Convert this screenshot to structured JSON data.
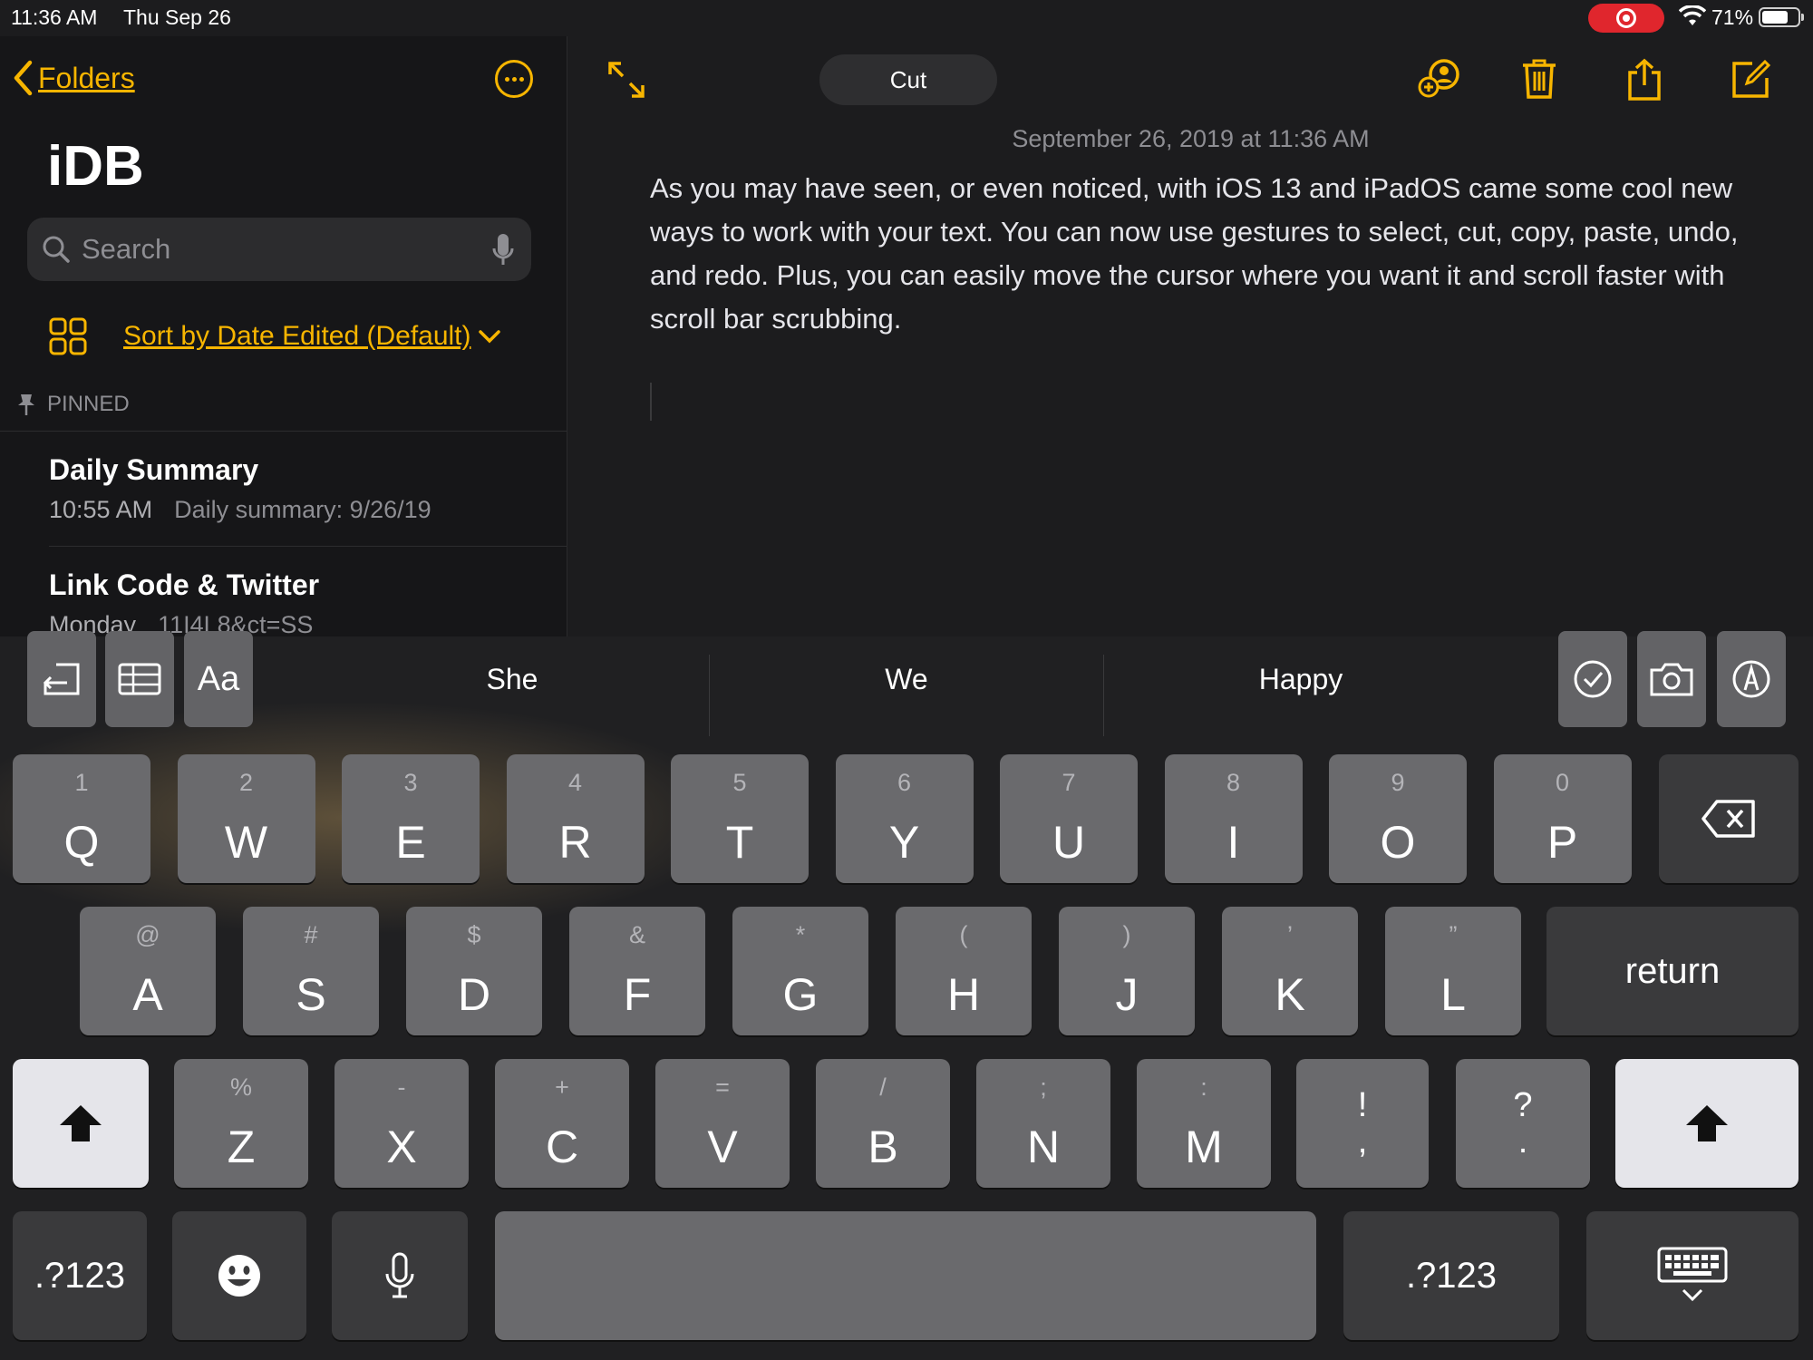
{
  "status_bar": {
    "time": "11:36 AM",
    "date": "Thu Sep 26",
    "battery": "71%"
  },
  "sidebar": {
    "back_label": "Folders",
    "folder_title": "iDB",
    "search_placeholder": "Search",
    "sort_label": "Sort by Date Edited (Default)",
    "pinned_label": "PINNED",
    "notes": [
      {
        "title": "Daily Summary",
        "time": "10:55 AM",
        "preview": "Daily summary: 9/26/19"
      },
      {
        "title": "Link Code & Twitter",
        "time": "Monday",
        "preview": "11I4L8&ct=SS"
      }
    ]
  },
  "editor": {
    "edit_action": "Cut",
    "date": "September 26, 2019 at 11:36 AM",
    "body": "As you may have seen, or even noticed, with iOS 13 and iPadOS came some cool new ways to work with your text. You can now use gestures to select, cut, copy, paste, undo, and redo. Plus, you can easily move the cursor where you want it and scroll faster with scroll bar scrubbing."
  },
  "quicktype": {
    "format_label": "Aa",
    "predictions": [
      "She",
      "We",
      "Happy"
    ]
  },
  "keyboard": {
    "row1": [
      {
        "alt": "1",
        "main": "Q"
      },
      {
        "alt": "2",
        "main": "W"
      },
      {
        "alt": "3",
        "main": "E"
      },
      {
        "alt": "4",
        "main": "R"
      },
      {
        "alt": "5",
        "main": "T"
      },
      {
        "alt": "6",
        "main": "Y"
      },
      {
        "alt": "7",
        "main": "U"
      },
      {
        "alt": "8",
        "main": "I"
      },
      {
        "alt": "9",
        "main": "O"
      },
      {
        "alt": "0",
        "main": "P"
      }
    ],
    "row2": [
      {
        "alt": "@",
        "main": "A"
      },
      {
        "alt": "#",
        "main": "S"
      },
      {
        "alt": "$",
        "main": "D"
      },
      {
        "alt": "&",
        "main": "F"
      },
      {
        "alt": "*",
        "main": "G"
      },
      {
        "alt": "(",
        "main": "H"
      },
      {
        "alt": ")",
        "main": "J"
      },
      {
        "alt": "’",
        "main": "K"
      },
      {
        "alt": "”",
        "main": "L"
      }
    ],
    "row3": [
      {
        "alt": "%",
        "main": "Z"
      },
      {
        "alt": "-",
        "main": "X"
      },
      {
        "alt": "+",
        "main": "C"
      },
      {
        "alt": "=",
        "main": "V"
      },
      {
        "alt": "/",
        "main": "B"
      },
      {
        "alt": ";",
        "main": "N"
      },
      {
        "alt": ":",
        "main": "M"
      }
    ],
    "punct": [
      {
        "top": "!",
        "bottom": ","
      },
      {
        "top": "?",
        "bottom": "."
      }
    ],
    "return_label": "return",
    "numbers_label": ".?123"
  }
}
